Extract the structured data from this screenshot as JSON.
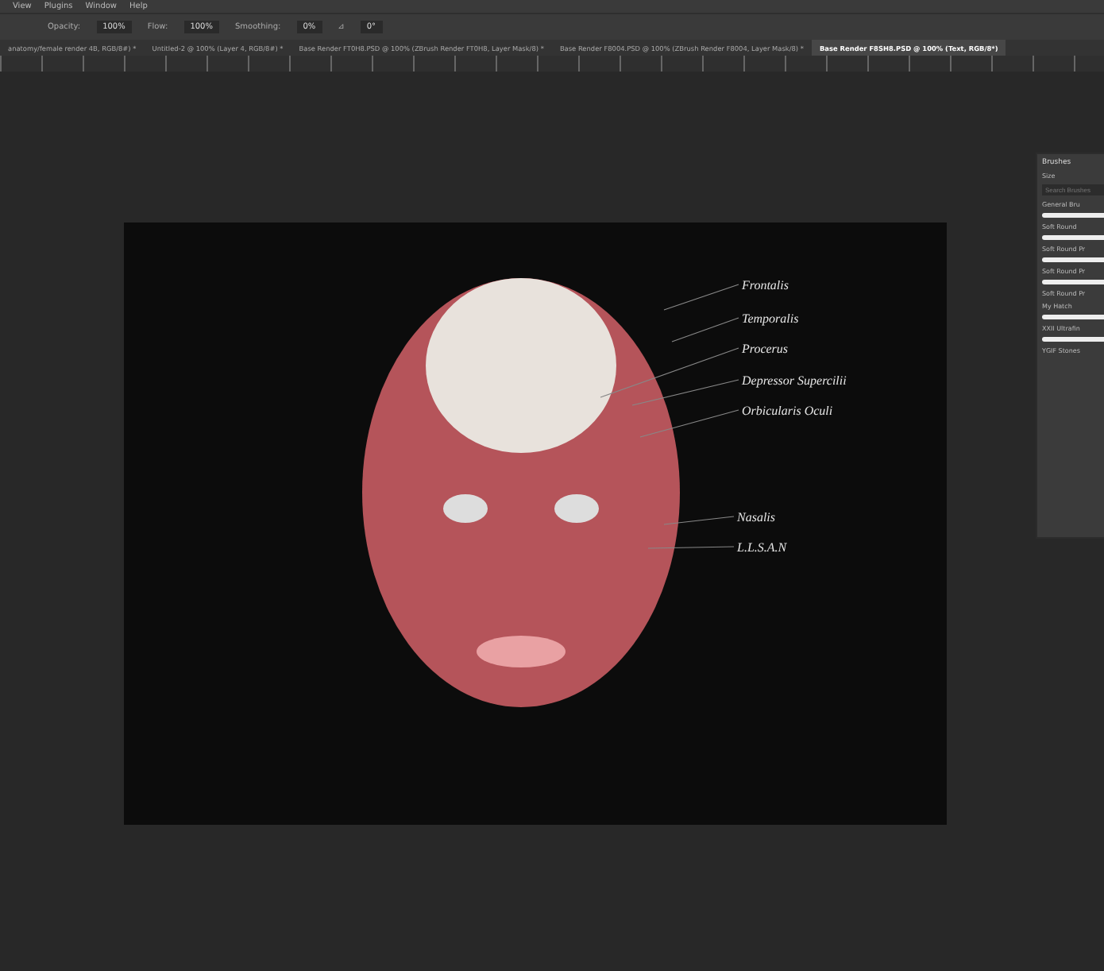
{
  "menu": [
    "View",
    "Plugins",
    "Window",
    "Help"
  ],
  "options": [
    {
      "label": "Opacity:",
      "value": "100%"
    },
    {
      "label": "Flow:",
      "value": "100%"
    },
    {
      "label": "Smoothing:",
      "value": "0%"
    }
  ],
  "angle": {
    "label": "⊿",
    "value": "0°"
  },
  "tabs": [
    {
      "label": "anatomy/female render 4B, RGB/8#) *",
      "selected": false
    },
    {
      "label": "Untitled-2 @ 100% (Layer 4, RGB/8#) *",
      "selected": false
    },
    {
      "label": "Base Render FT0H8.PSD @ 100% (ZBrush Render FT0H8, Layer Mask/8) *",
      "selected": false
    },
    {
      "label": "Base Render F8004.PSD @ 100% (ZBrush Render F8004, Layer Mask/8) *",
      "selected": false
    },
    {
      "label": "Base Render F8SH8.PSD @ 100% (Text, RGB/8*)",
      "selected": true
    }
  ],
  "document": {
    "labels": [
      "Frontalis",
      "Temporalis",
      "Procerus",
      "Depressor Supercilii",
      "Orbicularis Oculi",
      "Nasalis",
      "L.L.S.A.N"
    ]
  },
  "brushes_panel": {
    "title": "Brushes",
    "size_label": "Size",
    "search": {
      "placeholder": "Search Brushes"
    },
    "groups": [
      {
        "name": "General Bru",
        "brushes": [
          "Soft Round",
          "Soft Round Pr",
          "Soft Round Pr",
          "Soft Round Pr"
        ]
      },
      {
        "name": "My Hatch",
        "brushes": [
          "XXII Ultrafin",
          "YGIF Stones"
        ]
      }
    ]
  }
}
